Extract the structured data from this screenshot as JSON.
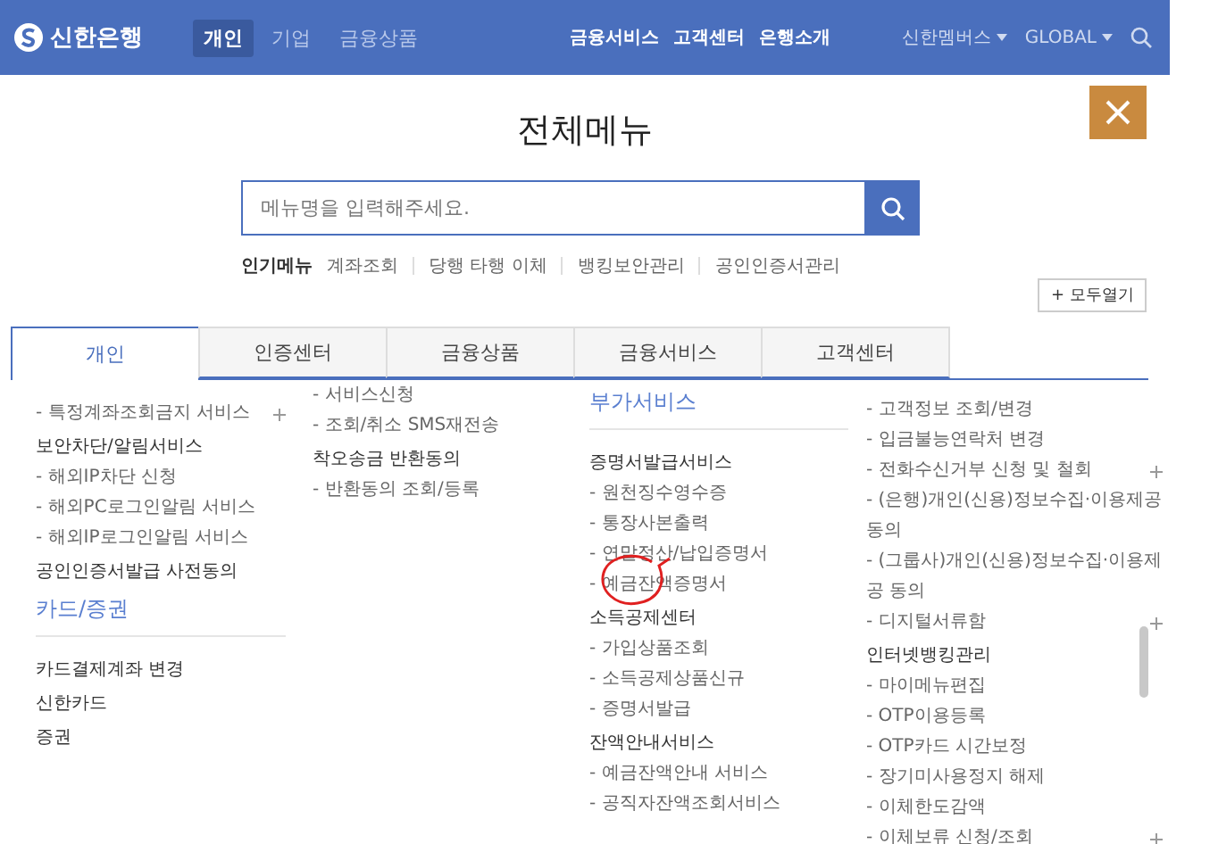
{
  "header": {
    "logo": "신한은행",
    "nav": [
      {
        "label": "개인",
        "selected": true
      },
      {
        "label": "기업",
        "selected": false
      },
      {
        "label": "금융상품",
        "selected": false
      }
    ],
    "links": [
      "금융서비스",
      "고객센터",
      "은행소개"
    ],
    "dropdowns": [
      "신한멤버스",
      "GLOBAL"
    ]
  },
  "title": "전체메뉴",
  "search": {
    "placeholder": "메뉴명을 입력해주세요."
  },
  "popular": {
    "label": "인기메뉴",
    "items": [
      "계좌조회",
      "당행 타행 이체",
      "뱅킹보안관리",
      "공인인증서관리"
    ]
  },
  "expand_all": {
    "icon": "+",
    "label": "모두열기"
  },
  "tabs": [
    {
      "label": "개인",
      "selected": true
    },
    {
      "label": "인증센터",
      "selected": false
    },
    {
      "label": "금융상품",
      "selected": false
    },
    {
      "label": "금융서비스",
      "selected": false
    },
    {
      "label": "고객센터",
      "selected": false
    }
  ],
  "columns": [
    [
      {
        "kind": "link",
        "text": "- 특정계좌조회금지 서비스",
        "expandable": true
      },
      {
        "kind": "group",
        "text": "보안차단/알림서비스",
        "expandable": false
      },
      {
        "kind": "link",
        "text": "- 해외IP차단 신청",
        "expandable": false
      },
      {
        "kind": "link",
        "text": "- 해외PC로그인알림 서비스",
        "expandable": false
      },
      {
        "kind": "link",
        "text": "- 해외IP로그인알림 서비스",
        "expandable": false
      },
      {
        "kind": "group",
        "text": "공인인증서발급 사전동의",
        "expandable": false
      },
      {
        "kind": "section",
        "text": "카드/증권",
        "expandable": false
      },
      {
        "kind": "group",
        "text": "카드결제계좌 변경",
        "expandable": false
      },
      {
        "kind": "group",
        "text": "신한카드",
        "expandable": false
      },
      {
        "kind": "group",
        "text": "증권",
        "expandable": false
      }
    ],
    [
      {
        "kind": "link",
        "text": "- 서비스신청",
        "expandable": false
      },
      {
        "kind": "link",
        "text": "- 조회/취소 SMS재전송",
        "expandable": false
      },
      {
        "kind": "group",
        "text": "착오송금 반환동의",
        "expandable": false
      },
      {
        "kind": "link",
        "text": "- 반환동의 조회/등록",
        "expandable": false
      }
    ],
    [
      {
        "kind": "section",
        "text": "부가서비스",
        "expandable": false
      },
      {
        "kind": "group",
        "text": "증명서발급서비스",
        "expandable": false
      },
      {
        "kind": "link",
        "text": "- 원천징수영수증",
        "expandable": false
      },
      {
        "kind": "link",
        "text": "- 통장사본출력",
        "expandable": false
      },
      {
        "kind": "link",
        "text": "- 연말정산/납입증명서",
        "expandable": false
      },
      {
        "kind": "link",
        "text": "- 예금잔액증명서",
        "expandable": false
      },
      {
        "kind": "group",
        "text": "소득공제센터",
        "expandable": false
      },
      {
        "kind": "link",
        "text": "- 가입상품조회",
        "expandable": false
      },
      {
        "kind": "link",
        "text": "- 소득공제상품신규",
        "expandable": false
      },
      {
        "kind": "link",
        "text": "- 증명서발급",
        "expandable": false
      },
      {
        "kind": "group",
        "text": "잔액안내서비스",
        "expandable": false
      },
      {
        "kind": "link",
        "text": "- 예금잔액안내 서비스",
        "expandable": false
      },
      {
        "kind": "link",
        "text": "- 공직자잔액조회서비스",
        "expandable": false
      }
    ],
    [
      {
        "kind": "link",
        "text": "- 고객정보 조회/변경",
        "expandable": false
      },
      {
        "kind": "link",
        "text": "- 입금불능연락처 변경",
        "expandable": false
      },
      {
        "kind": "link",
        "text": "- 전화수신거부 신청 및 철회",
        "expandable": true
      },
      {
        "kind": "link",
        "text": "- (은행)개인(신용)정보수집·이용제공 동의",
        "expandable": false
      },
      {
        "kind": "link",
        "text": "- (그룹사)개인(신용)정보수집·이용제공 동의",
        "expandable": false
      },
      {
        "kind": "link",
        "text": "- 디지털서류함",
        "expandable": true
      },
      {
        "kind": "group",
        "text": "인터넷뱅킹관리",
        "expandable": false
      },
      {
        "kind": "link",
        "text": "- 마이메뉴편집",
        "expandable": false
      },
      {
        "kind": "link",
        "text": "- OTP이용등록",
        "expandable": false
      },
      {
        "kind": "link",
        "text": "- OTP카드 시간보정",
        "expandable": false
      },
      {
        "kind": "link",
        "text": "- 장기미사용정지 해제",
        "expandable": false
      },
      {
        "kind": "link",
        "text": "- 이체한도감액",
        "expandable": false
      },
      {
        "kind": "link",
        "text": "- 이체보류 신청/조회",
        "expandable": true
      }
    ]
  ]
}
